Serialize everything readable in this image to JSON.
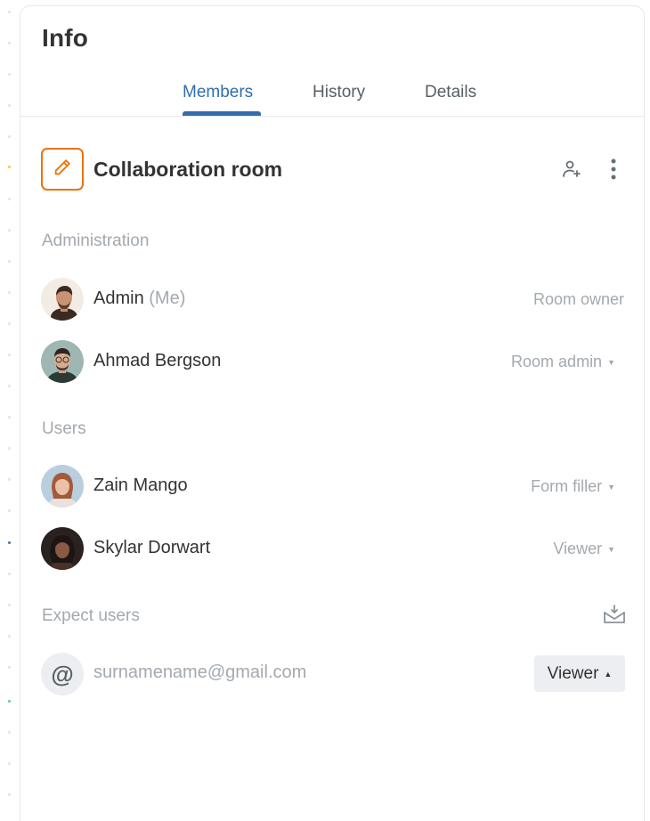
{
  "panel": {
    "title": "Info"
  },
  "tabs": [
    {
      "label": "Members",
      "active": true
    },
    {
      "label": "History",
      "active": false
    },
    {
      "label": "Details",
      "active": false
    }
  ],
  "room": {
    "title": "Collaboration room",
    "icon": "pencil-icon",
    "accent": "#ED7309"
  },
  "sections": {
    "administration": "Administration",
    "users": "Users",
    "expect_users": "Expect users"
  },
  "admins": [
    {
      "name": "Admin",
      "suffix": "(Me)",
      "role": "Room owner",
      "has_dropdown": false
    },
    {
      "name": "Ahmad Bergson",
      "suffix": "",
      "role": "Room admin",
      "has_dropdown": true
    }
  ],
  "users": [
    {
      "name": "Zain Mango",
      "role": "Form filler",
      "has_dropdown": true
    },
    {
      "name": "Skylar Dorwart",
      "role": "Viewer",
      "has_dropdown": true
    }
  ],
  "expected": [
    {
      "email": "surnamename@gmail.com",
      "avatar_symbol": "@",
      "role": "Viewer"
    }
  ],
  "colors": {
    "accent": "#316DAA",
    "muted_text": "#A3A9AE",
    "text": "#333333"
  }
}
